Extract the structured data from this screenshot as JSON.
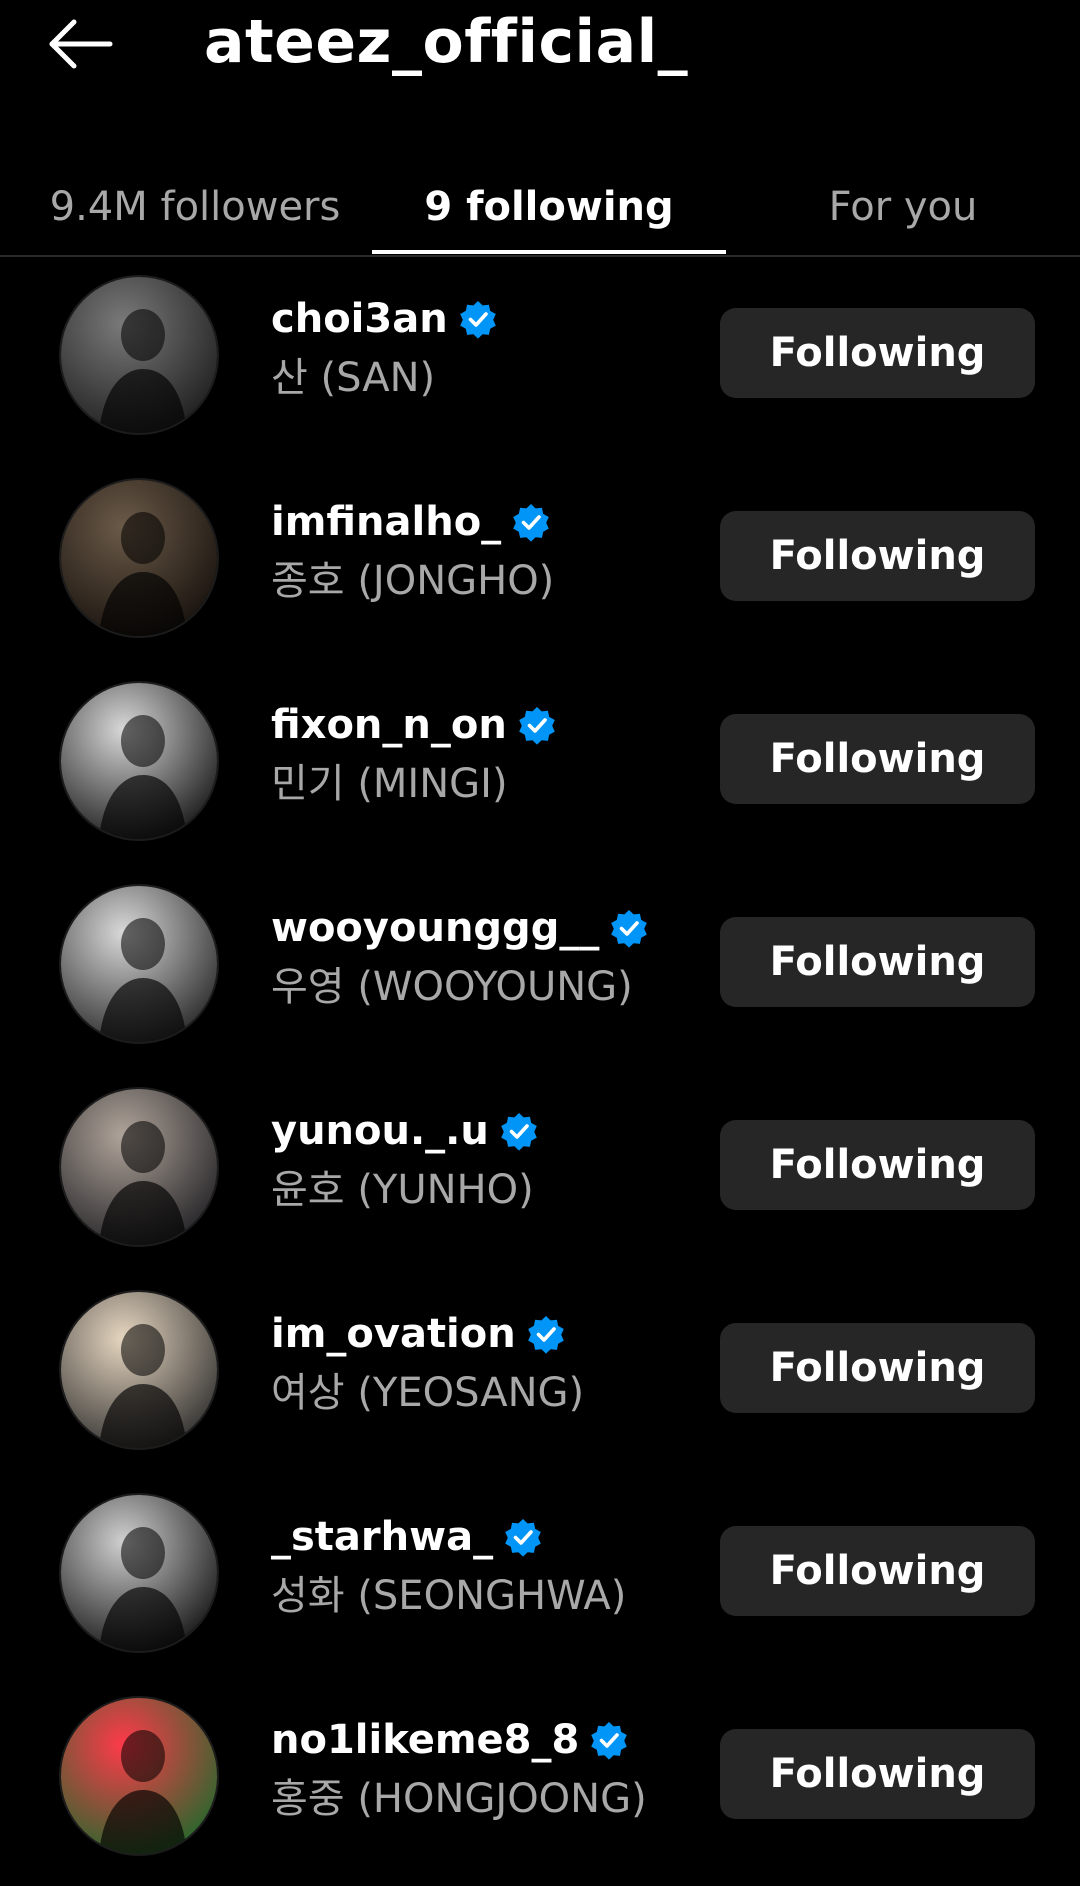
{
  "header": {
    "back_icon": "arrow-left-icon",
    "title": "ateez_official_"
  },
  "tabs": [
    {
      "label": "9.4M followers",
      "active": false
    },
    {
      "label": "9 following",
      "active": true
    },
    {
      "label": "For you",
      "active": false
    }
  ],
  "colors": {
    "background": "#000000",
    "text_primary": "#ffffff",
    "text_secondary": "#a8a8a8",
    "button_bg": "#262626",
    "verified_blue": "#0095f6"
  },
  "following": [
    {
      "username": "choi3an",
      "full_name": "산 (SAN)",
      "verified": true,
      "button": "Following",
      "avatar_tone": [
        "#7a7a7a",
        "#1a1a1a"
      ]
    },
    {
      "username": "imfinalho_",
      "full_name": "종호 (JONGHO)",
      "verified": true,
      "button": "Following",
      "avatar_tone": [
        "#6b5a48",
        "#140f0b"
      ]
    },
    {
      "username": "fixon_n_on",
      "full_name": "민기 (MINGI)",
      "verified": true,
      "button": "Following",
      "avatar_tone": [
        "#d8d8d8",
        "#111111"
      ]
    },
    {
      "username": "wooyounggg__",
      "full_name": "우영 (WOOYOUNG)",
      "verified": true,
      "button": "Following",
      "avatar_tone": [
        "#d9d9d9",
        "#222222"
      ]
    },
    {
      "username": "yunou._.u",
      "full_name": "윤호 (YUNHO)",
      "verified": true,
      "button": "Following",
      "avatar_tone": [
        "#b0a49a",
        "#1e1e22"
      ]
    },
    {
      "username": "im_ovation",
      "full_name": "여상 (YEOSANG)",
      "verified": true,
      "button": "Following",
      "avatar_tone": [
        "#e6d6c0",
        "#2a2a2a"
      ]
    },
    {
      "username": "_starhwa_",
      "full_name": "성화 (SEONGHWA)",
      "verified": true,
      "button": "Following",
      "avatar_tone": [
        "#d0d0d0",
        "#0e0e0e"
      ]
    },
    {
      "username": "no1likeme8_8",
      "full_name": "홍중 (HONGJOONG)",
      "verified": true,
      "button": "Following",
      "avatar_tone": [
        "#ff3a4a",
        "#1a6a2a"
      ]
    }
  ]
}
